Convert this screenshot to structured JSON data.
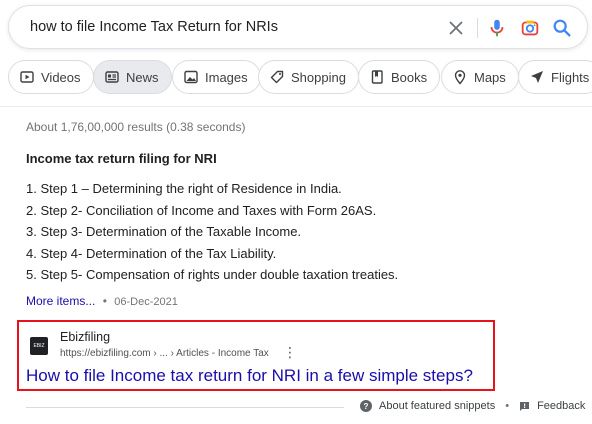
{
  "search": {
    "query": "how to file Income Tax Return for NRIs"
  },
  "chips": [
    {
      "label": "Videos",
      "icon": "video-icon"
    },
    {
      "label": "News",
      "icon": "news-icon"
    },
    {
      "label": "Images",
      "icon": "images-icon"
    },
    {
      "label": "Shopping",
      "icon": "shopping-tag-icon"
    },
    {
      "label": "Books",
      "icon": "book-icon"
    },
    {
      "label": "Maps",
      "icon": "map-pin-icon"
    },
    {
      "label": "Flights",
      "icon": "plane-icon"
    }
  ],
  "results": {
    "stats": "About 1,76,00,000 results (0.38 seconds)"
  },
  "snippet": {
    "title": "Income tax return filing for NRI",
    "steps": [
      "1. Step 1 – Determining the right of Residence in India.",
      "2. Step 2- Conciliation of Income and Taxes with Form 26AS.",
      "3. Step 3- Determination of the Taxable Income.",
      "4. Step 4- Determination of the Tax Liability.",
      "5. Step 5- Compensation of rights under double taxation treaties."
    ],
    "more_label": "More items...",
    "dot": "•",
    "date": "06-Dec-2021"
  },
  "source": {
    "site_name": "Ebizfiling",
    "url": "https://ebizfiling.com › ... › Articles - Income Tax",
    "title": "How to file Income tax return for NRI in a few simple steps?",
    "favicon_text": "EBIZ"
  },
  "footer": {
    "about_label": "About featured snippets",
    "separator": "•",
    "feedback_label": "Feedback"
  },
  "colors": {
    "link": "#1a0dab",
    "highlight_border": "#e8121c"
  }
}
